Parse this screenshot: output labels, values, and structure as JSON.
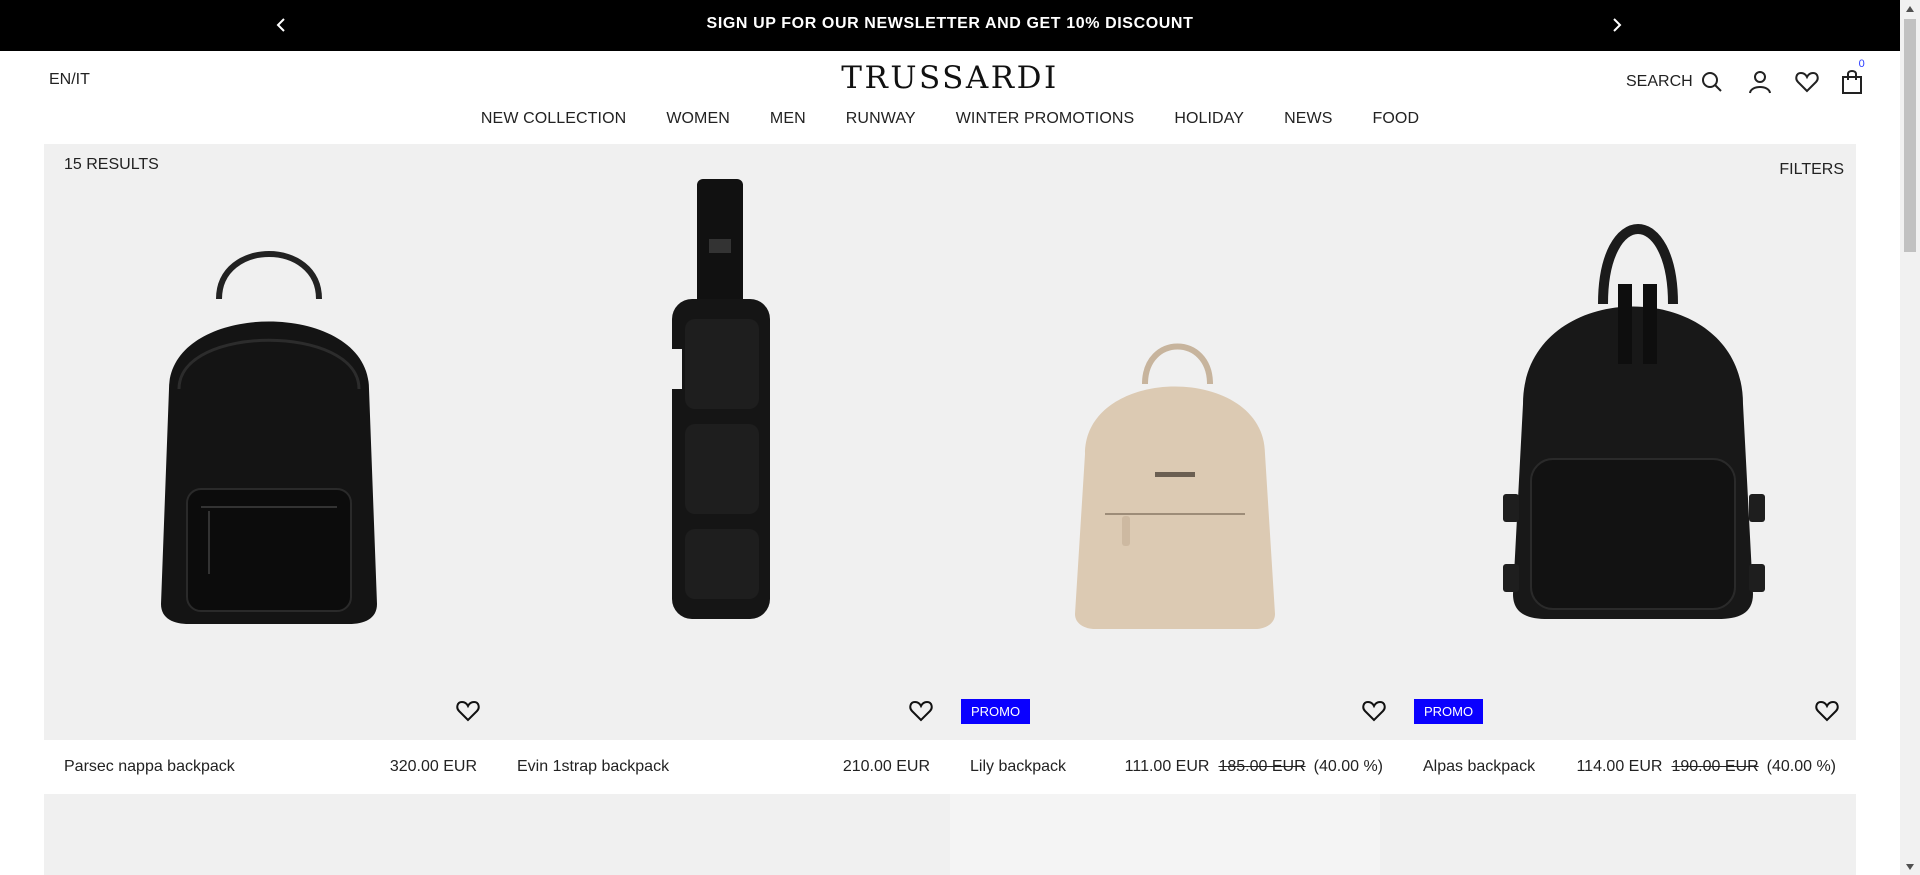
{
  "announcement": {
    "text": "SIGN UP FOR OUR NEWSLETTER AND GET 10% DISCOUNT"
  },
  "header": {
    "language": "EN/IT",
    "logo": "TRUSSARDI",
    "search_label": "SEARCH",
    "bag_count": "0"
  },
  "nav": {
    "items": [
      "NEW COLLECTION",
      "WOMEN",
      "MEN",
      "RUNWAY",
      "WINTER PROMOTIONS",
      "HOLIDAY",
      "NEWS",
      "FOOD"
    ]
  },
  "listing": {
    "results": "15 RESULTS",
    "filters_label": "FILTERS",
    "products": [
      {
        "name": "Parsec nappa backpack",
        "price": "320.00 EUR",
        "old_price": "",
        "discount": "",
        "badge": ""
      },
      {
        "name": "Evin 1strap backpack",
        "price": "210.00 EUR",
        "old_price": "",
        "discount": "",
        "badge": ""
      },
      {
        "name": "Lily backpack",
        "price": "111.00 EUR",
        "old_price": "185.00 EUR",
        "discount": "(40.00 %)",
        "badge": "PROMO"
      },
      {
        "name": "Alpas backpack",
        "price": "114.00 EUR",
        "old_price": "190.00 EUR",
        "discount": "(40.00 %)",
        "badge": "PROMO"
      }
    ]
  },
  "icons": {
    "search": "search-icon",
    "user": "user-icon",
    "wishlist": "heart-icon",
    "bag": "shopping-bag-icon"
  },
  "colors": {
    "promo_badge": "#0a00ff",
    "bag_count": "#2a3cff",
    "card_bg": "#f0f0f0"
  }
}
